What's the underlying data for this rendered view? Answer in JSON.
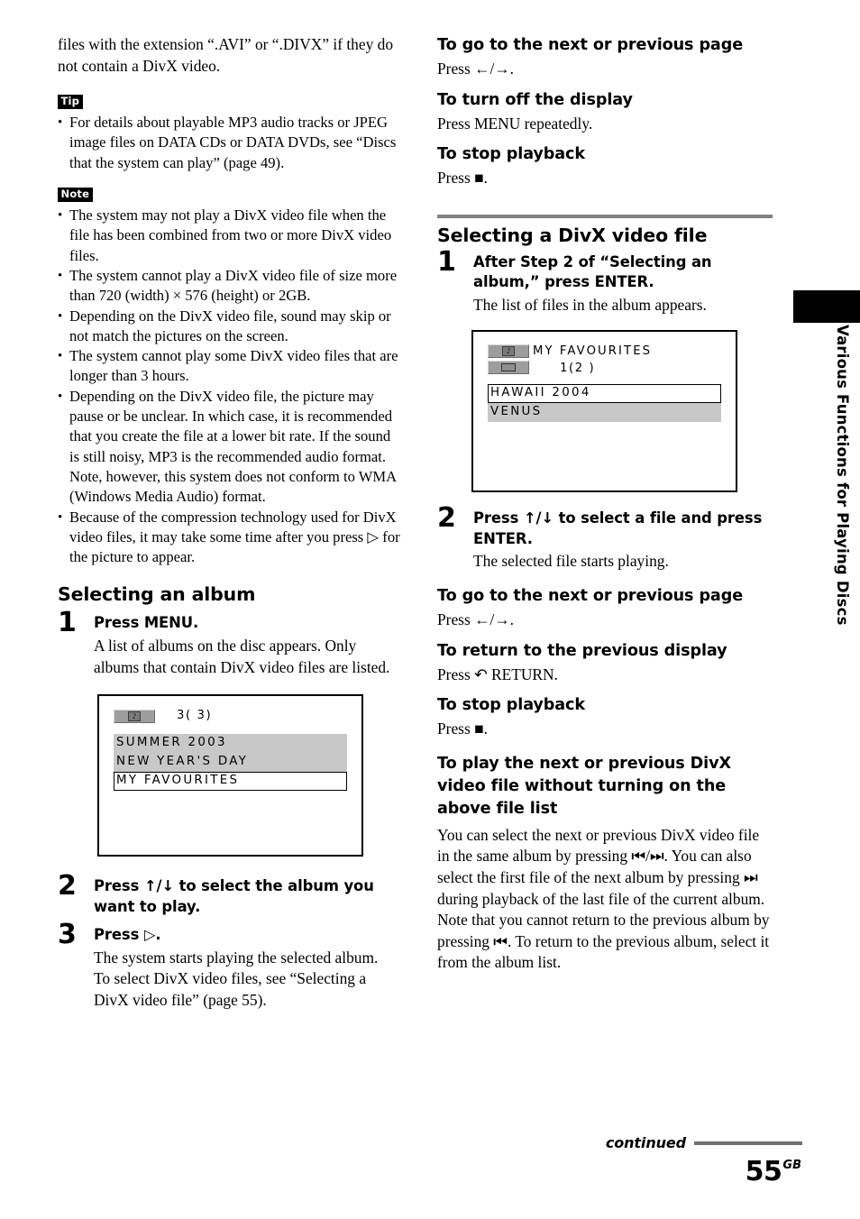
{
  "document": {
    "page_number": "55",
    "page_suffix": "GB",
    "continued_label": "continued",
    "side_tab_label": "Various Functions for Playing Discs"
  },
  "left_column": {
    "intro_paragraph": "files with the extension “.AVI” or “.DIVX” if they do not contain a DivX video.",
    "tip": {
      "badge": "Tip",
      "items": [
        "For details about playable MP3 audio tracks or JPEG image files on DATA CDs or DATA DVDs, see “Discs that the system can play” (page 49)."
      ]
    },
    "note": {
      "badge": "Note",
      "items": [
        "The system may not play a DivX video file when the file has been combined from two or more DivX video files.",
        "The system cannot play a DivX video file of size more than 720 (width) × 576 (height) or 2GB.",
        "Depending on the DivX video file, sound may skip or not match the pictures on the screen.",
        "The system cannot play some DivX video files that are longer than 3 hours.",
        "Depending on the DivX video file, the picture may pause or be unclear. In which case, it is recommended that you create the file at a lower bit rate. If the sound is still noisy, MP3 is the recommended audio format. Note, however, this system does not conform to WMA (Windows Media Audio) format.",
        "Because of the compression technology used for DivX video files, it may take some time after you press ▷ for the picture to appear."
      ]
    },
    "section": {
      "heading": "Selecting an album",
      "steps": [
        {
          "number": "1",
          "lead": "Press MENU.",
          "desc": "A list of albums on the disc appears. Only albums that contain DivX video files are listed."
        },
        {
          "number": "2",
          "lead": "Press ↑/↓ to select the album you want to play.",
          "desc": ""
        },
        {
          "number": "3",
          "lead": "Press ▷.",
          "desc": "The system starts playing the selected album.\nTo select DivX video files, see “Selecting a DivX video file” (page 55)."
        }
      ]
    },
    "album_screen": {
      "icon_name": "album-icon",
      "counter": "3( 3)",
      "rows": [
        {
          "label": "SUMMER 2003",
          "selected": false
        },
        {
          "label": "NEW YEAR'S DAY",
          "selected": false
        },
        {
          "label": "MY FAVOURITES",
          "selected": true
        }
      ]
    }
  },
  "right_column": {
    "top_blocks": [
      {
        "heading": "To go to the next or previous page",
        "body": "Press ←/→."
      },
      {
        "heading": "To turn off the display",
        "body": "Press MENU repeatedly."
      },
      {
        "heading": "To stop playback",
        "body": "Press ■."
      }
    ],
    "section": {
      "heading": "Selecting a DivX video file",
      "steps": [
        {
          "number": "1",
          "lead": "After Step 2 of “Selecting an album,” press ENTER.",
          "desc": "The list of files in the album appears."
        },
        {
          "number": "2",
          "lead": "Press ↑/↓ to select a file and press ENTER.",
          "desc": "The selected file starts playing."
        }
      ]
    },
    "file_screen": {
      "album_icon_name": "album-icon",
      "file_icon_name": "film-icon",
      "album_title": "MY FAVOURITES",
      "counter": "1(2 )",
      "rows": [
        {
          "label": "HAWAII 2004",
          "selected": true
        },
        {
          "label": "VENUS",
          "selected": false
        }
      ]
    },
    "bottom_blocks": [
      {
        "heading": "To go to the next or previous page",
        "body": "Press ←/→."
      },
      {
        "heading": "To return to the previous display",
        "body": "Press ↶ RETURN."
      },
      {
        "heading": "To stop playback",
        "body": "Press ■."
      }
    ],
    "final_block": {
      "heading": "To play the next or previous DivX video file without turning on the above file list",
      "body": "You can select the next or previous DivX video file in the same album by pressing ⏮/⏭. You can also select the first file of the next album by pressing ⏭ during playback of the last file of the current album. Note that you cannot return to the previous album by pressing ⏮. To return to the previous album, select it from the album list."
    }
  }
}
